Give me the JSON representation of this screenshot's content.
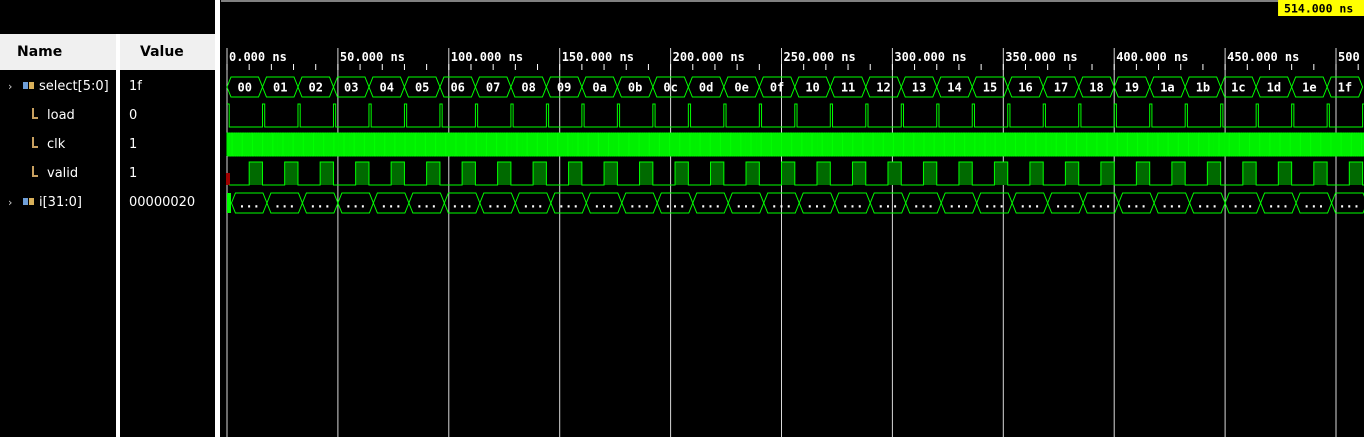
{
  "columns": {
    "name": "Name",
    "value": "Value"
  },
  "cursor": {
    "label": "514.000 ns"
  },
  "time_axis": {
    "unit": "ns",
    "labels": [
      "0.000 ns",
      "50.000 ns",
      "100.000 ns",
      "150.000 ns",
      "200.000 ns",
      "250.000 ns",
      "300.000 ns",
      "350.000 ns",
      "400.000 ns",
      "450.000 ns",
      "500"
    ]
  },
  "signals": [
    {
      "name": "select[5:0]",
      "value": "1f",
      "kind": "bus",
      "expandable": true
    },
    {
      "name": "load",
      "value": "0",
      "kind": "bit",
      "expandable": false
    },
    {
      "name": "clk",
      "value": "1",
      "kind": "bit",
      "expandable": false
    },
    {
      "name": "valid",
      "value": "1",
      "kind": "bit",
      "expandable": false
    },
    {
      "name": "i[31:0]",
      "value": "00000020",
      "kind": "bus",
      "expandable": true
    }
  ],
  "select_values": [
    "00",
    "01",
    "02",
    "03",
    "04",
    "05",
    "06",
    "07",
    "08",
    "09",
    "0a",
    "0b",
    "0c",
    "0d",
    "0e",
    "0f",
    "10",
    "11",
    "12",
    "13",
    "14",
    "15",
    "16",
    "17",
    "18",
    "19",
    "1a",
    "1b",
    "1c",
    "1d",
    "1e",
    "1f"
  ],
  "i_value_text": "...",
  "colors": {
    "wave": "#00ff00",
    "cursor_bg": "#ffff00",
    "grid": "#ffffff",
    "header_bg": "#f0f0f0"
  },
  "icons": {
    "bus": "bus-icon",
    "bit": "bit-icon",
    "expand": "chevron-right-icon"
  }
}
